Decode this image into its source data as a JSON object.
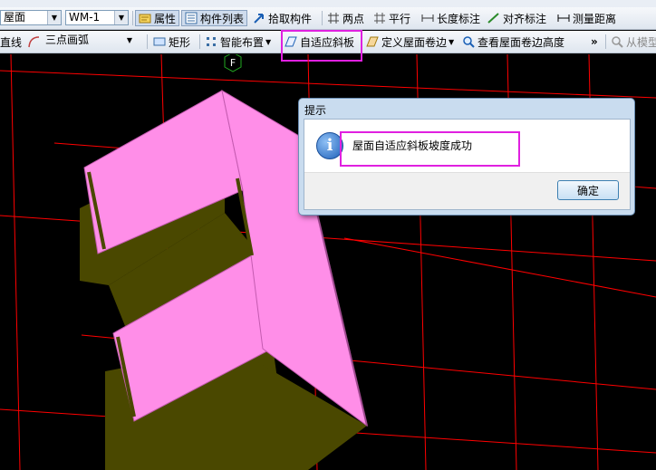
{
  "toolbar1": {
    "layer_select": "屋面",
    "component_select": "WM-1",
    "properties": "属性",
    "component_list": "构件列表",
    "pick_component": "拾取构件",
    "two_points": "两点",
    "parallel": "平行",
    "length_dim": "长度标注",
    "align_dim": "对齐标注",
    "measure_distance": "测量距离"
  },
  "toolbar2": {
    "line": "直线",
    "arc_select": "三点画弧",
    "rectangle": "矩形",
    "smart_layout": "智能布置",
    "adaptive_slab": "自适应斜板",
    "define_roof_edge": "定义屋面卷边",
    "view_roof_edge_height": "查看屋面卷边高度",
    "overflow": "»",
    "from_model": "从模型"
  },
  "viewport": {
    "axis_marker": "F"
  },
  "dialog": {
    "title": "提示",
    "message": "屋面自适应斜板坡度成功",
    "ok_label": "确定"
  },
  "colors": {
    "grid": "#ff0000",
    "roof_pink": "#ff8ee8",
    "wall_olive": "#4a4800",
    "highlight": "#e020e0"
  }
}
